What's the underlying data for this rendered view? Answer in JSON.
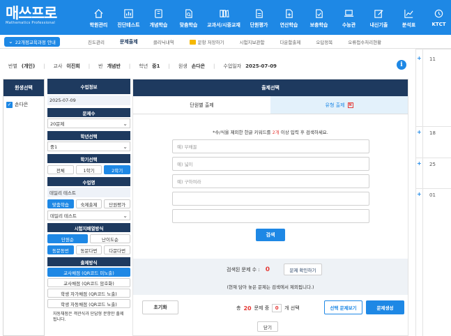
{
  "header": {
    "brand": "매쓰프로",
    "brand_sub": "Mathematics Professional",
    "nav": [
      {
        "label": "학원관리",
        "icon": "home-icon"
      },
      {
        "label": "진단테스트",
        "icon": "bar-chart-icon"
      },
      {
        "label": "개념학습",
        "icon": "book-icon"
      },
      {
        "label": "맞춤학습",
        "icon": "search-doc-icon"
      },
      {
        "label": "교과서/시중교재",
        "icon": "books-icon"
      },
      {
        "label": "단원평가",
        "icon": "doc-icon"
      },
      {
        "label": "연산학습",
        "icon": "doc-plus-icon"
      },
      {
        "label": "보충학습",
        "icon": "doc-check-icon"
      },
      {
        "label": "수능관",
        "icon": "laptop-icon"
      },
      {
        "label": "내신기출",
        "icon": "edit-icon"
      },
      {
        "label": "분석표",
        "icon": "line-chart-icon"
      },
      {
        "label": "KTCT",
        "icon": "ktct-icon"
      }
    ]
  },
  "subbar": {
    "curriculum_button": "22개정교육과정 안내",
    "items": [
      "진도관리",
      "문제출제",
      "클리닉내역",
      "문항 저장하기",
      "시험지보관함",
      "다운함출제",
      "오답정복",
      "오류접수처리현황"
    ],
    "active_index": 1
  },
  "info": {
    "class_label": "반별",
    "class_value": "(개인)",
    "teacher_label": "교사",
    "teacher_value": "이진희",
    "group_label": "반",
    "group_value": "개념반",
    "grade_label": "학년",
    "grade_value": "중1",
    "student_label": "원생",
    "student_value": "손다은",
    "date_label": "수업일자",
    "date_value": "2025-07-09"
  },
  "left": {
    "title": "원생선택",
    "student": "손다은"
  },
  "mid": {
    "title": "수업정보",
    "date": "2025-07-09",
    "count_title": "문제수",
    "count_value": "20문제",
    "grade_title": "학년선택",
    "grade_value": "중1",
    "term_title": "학기선택",
    "terms": [
      "전체",
      "1학기",
      "2학기"
    ],
    "lesson_title": "수업명",
    "lesson_value": "데일리 테스트",
    "lesson_types": [
      "맞춤학습",
      "숙제출제",
      "단원평가"
    ],
    "lesson_select": "데일리 테스트",
    "order_title": "시험지배열방식",
    "order_opts": [
      "단원순",
      "난이도순"
    ],
    "dup_opts": [
      "동문동번",
      "동문다번",
      "다문다번"
    ],
    "grade_method_title": "출제방식",
    "grade_methods": [
      "교사채점 (QR코드 미노출)",
      "교사채점 (QR코드 암호화)",
      "학생 자가채점 (QR코드 노출)",
      "학생 자동채점 (QR코드 노출)"
    ],
    "note": "자동채점은 객관식과 단답형 문항만 출제됩니다."
  },
  "main": {
    "title": "출제선택",
    "tab1": "단원별 출제",
    "tab2": "유형 출제",
    "tab2_badge": "N",
    "hint_pre": "*수/식을 제외한 한글 키워드를 ",
    "hint_red": "2개",
    "hint_post": " 이상 입력 후 검색하세요.",
    "placeholders": [
      "예) 부채꼴",
      "예) 넓이",
      "예) 구하여라",
      "",
      ""
    ],
    "search": "검색",
    "result_label": "검색된 문제 수 :",
    "result_count": "0",
    "confirm": "문제 확인하기",
    "result_note": "(현재 담아 놓은 문제는 검색에서 제외됩니다.)",
    "reset": "초기화",
    "total_label": "총",
    "total_num": "20",
    "total_unit": "문제 중",
    "selected_num": "0",
    "selected_unit": "개 선택",
    "view": "선택 문제보기",
    "generate": "문제생성",
    "close": "닫기"
  },
  "calendar": {
    "days": [
      "11",
      "18",
      "25",
      "01"
    ]
  },
  "colors": {
    "primary": "#1e88e5",
    "navy": "#1e3a5f",
    "accent": "#e53935"
  }
}
